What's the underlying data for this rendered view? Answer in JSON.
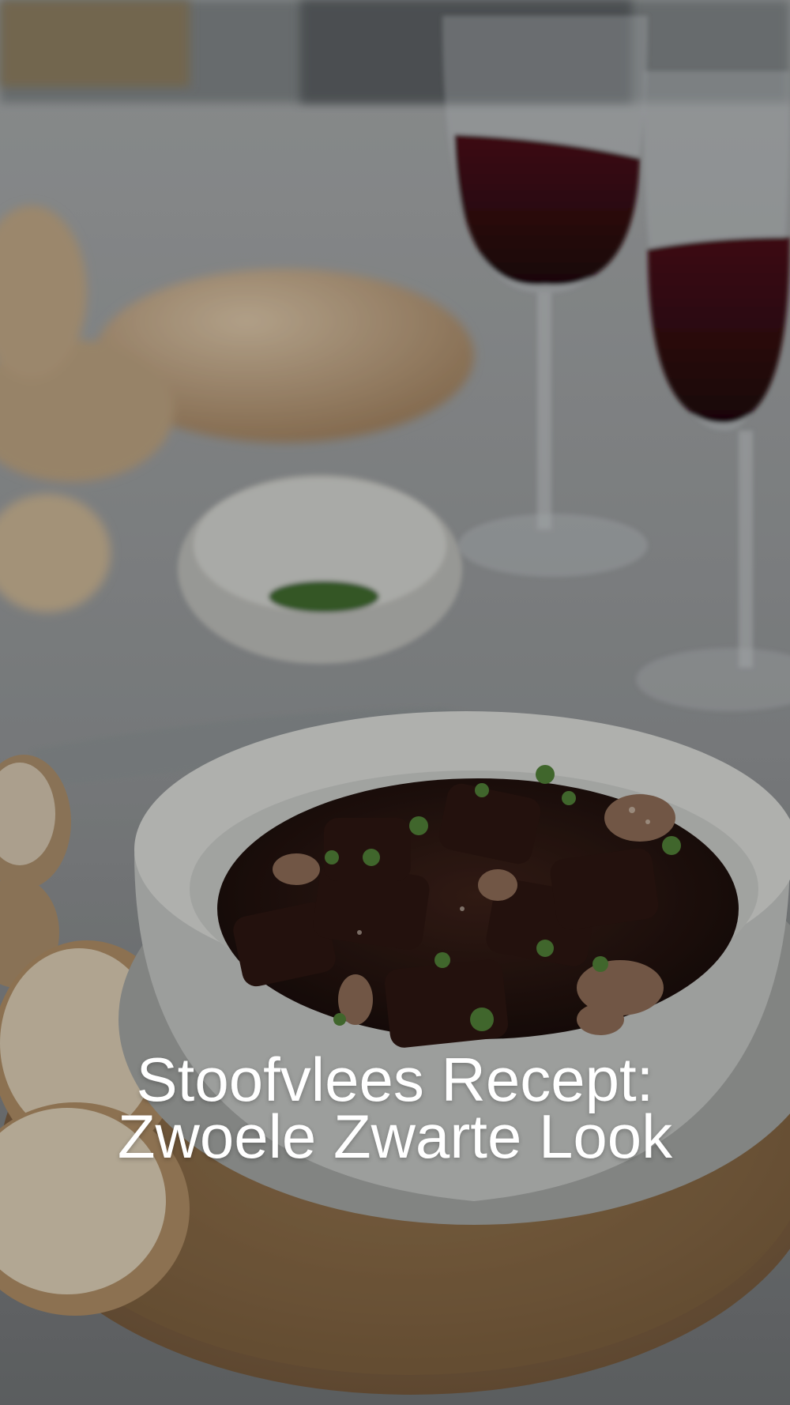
{
  "title": {
    "line1": "Stoofvlees Recept:",
    "line2": "Zwoele Zwarte Look"
  },
  "colors": {
    "background": "#2f3133",
    "text": "#ffffff",
    "board": "#8a6a4b",
    "bowl": "#d6d6d3",
    "stew": "#2a1714",
    "wine": "#3a0c12",
    "bread": "#b99a78"
  }
}
